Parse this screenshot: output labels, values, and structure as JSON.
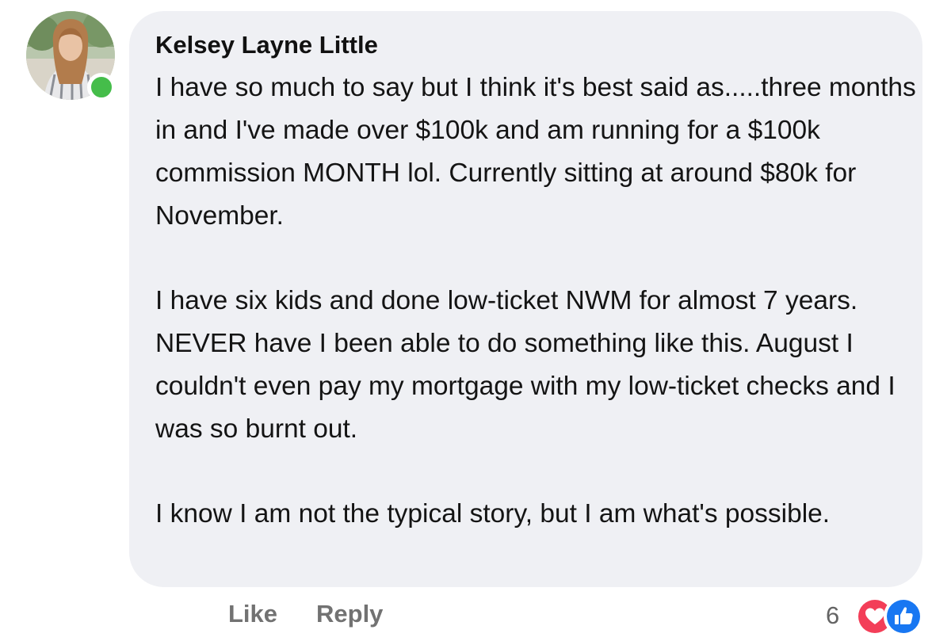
{
  "comment": {
    "author": "Kelsey Layne Little",
    "paragraphs": [
      "I have so much to say but I think it's best said as.....three months in and I've made over $100k and am running for a $100k commission MONTH lol. Currently sitting at around $80k for November.",
      "I have six kids and done low-ticket NWM for almost 7 years. NEVER have I been able to do something like this. August I couldn't even pay my mortgage with my low-ticket checks and I was so burnt out.",
      "I know I am not the typical story, but I am what's possible."
    ],
    "online": true
  },
  "actions": {
    "like_label": "Like",
    "reply_label": "Reply"
  },
  "reactions": {
    "count": "6",
    "types": [
      "love-icon",
      "like-icon"
    ],
    "colors": {
      "love": "#f33e58",
      "like": "#1877f2"
    }
  },
  "colors": {
    "bubble": "#eff0f4",
    "presence": "#45bd4a",
    "action_text": "#727272"
  }
}
